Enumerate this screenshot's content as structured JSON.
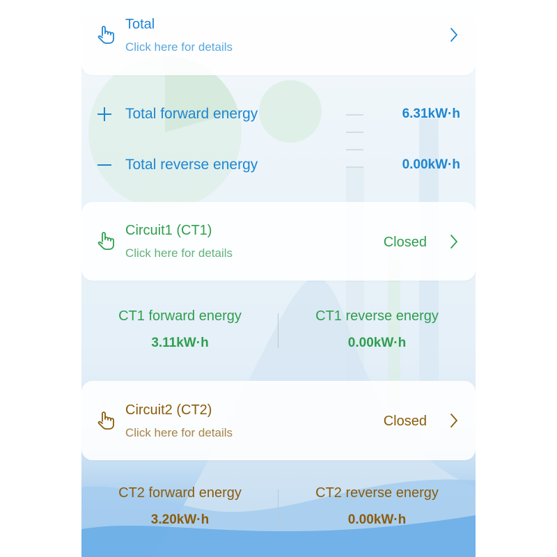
{
  "total": {
    "title": "Total",
    "subtitle": "Click here for details",
    "forward_label": "Total forward energy",
    "forward_value": "6.31kW·h",
    "reverse_label": "Total reverse energy",
    "reverse_value": "0.00kW·h"
  },
  "circuit1": {
    "title": "Circuit1 (CT1)",
    "subtitle": "Click here for details",
    "status": "Closed",
    "forward_label": "CT1 forward energy",
    "forward_value": "3.11kW·h",
    "reverse_label": "CT1 reverse energy",
    "reverse_value": "0.00kW·h"
  },
  "circuit2": {
    "title": "Circuit2 (CT2)",
    "subtitle": "Click here for details",
    "status": "Closed",
    "forward_label": "CT2 forward energy",
    "forward_value": "3.20kW·h",
    "reverse_label": "CT2 reverse energy",
    "reverse_value": "0.00kW·h"
  },
  "colors": {
    "total": "#1f86d1",
    "circuit1": "#2f9e4f",
    "circuit2": "#8a5c0c"
  },
  "icons": {
    "card": "hand-pointer-icon",
    "forward": "plus-icon",
    "reverse": "minus-icon",
    "navigate": "chevron-right-icon"
  }
}
